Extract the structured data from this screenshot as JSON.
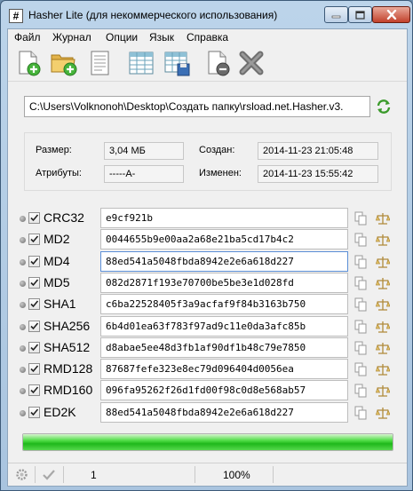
{
  "window": {
    "title": "Hasher Lite (для некоммерческого использования)",
    "app_icon_glyph": "#",
    "controls": [
      "minimize-icon",
      "maximize-icon",
      "close-icon"
    ]
  },
  "menu": [
    "Файл",
    "Журнал",
    "Опции",
    "Язык",
    "Справка"
  ],
  "toolbar": [
    "add-file-icon",
    "add-folder-icon",
    "document-icon",
    "table-icon",
    "save-table-icon",
    "remove-file-icon",
    "cancel-icon"
  ],
  "path": "C:\\Users\\Volknonoh\\Desktop\\Создать папку\\rsload.net.Hasher.v3.",
  "info": {
    "size_label": "Размер:",
    "size_value": "3,04 МБ",
    "attr_label": "Атрибуты:",
    "attr_value": "-----A-",
    "created_label": "Создан:",
    "created_value": "2014-11-23 21:05:48",
    "modified_label": "Изменен:",
    "modified_value": "2014-11-23 15:55:42"
  },
  "hashes": [
    {
      "name": "CRC32",
      "value": "e9cf921b"
    },
    {
      "name": "MD2",
      "value": "0044655b9e00aa2a68e21ba5cd17b4c2"
    },
    {
      "name": "MD4",
      "value": "88ed541a5048fbda8942e2e6a618d227"
    },
    {
      "name": "MD5",
      "value": "082d2871f193e70700be5be3e1d028fd"
    },
    {
      "name": "SHA1",
      "value": "c6ba22528405f3a9acfaf9f84b3163b750"
    },
    {
      "name": "SHA256",
      "value": "6b4d01ea63f783f97ad9c11e0da3afc85b"
    },
    {
      "name": "SHA512",
      "value": "d8abae5ee48d3fb1af90df1b48c79e7850"
    },
    {
      "name": "RMD128",
      "value": "87687fefe323e8ec79d096404d0056ea"
    },
    {
      "name": "RMD160",
      "value": "096fa95262f26d1fd00f98c0d8e568ab57"
    },
    {
      "name": "ED2K",
      "value": "88ed541a5048fbda8942e2e6a618d227"
    }
  ],
  "progress": 1.0,
  "status": {
    "count": "1",
    "percent": "100%"
  },
  "colors": {
    "progress": "#2fc52a",
    "refresh": "#3a9a2a"
  }
}
